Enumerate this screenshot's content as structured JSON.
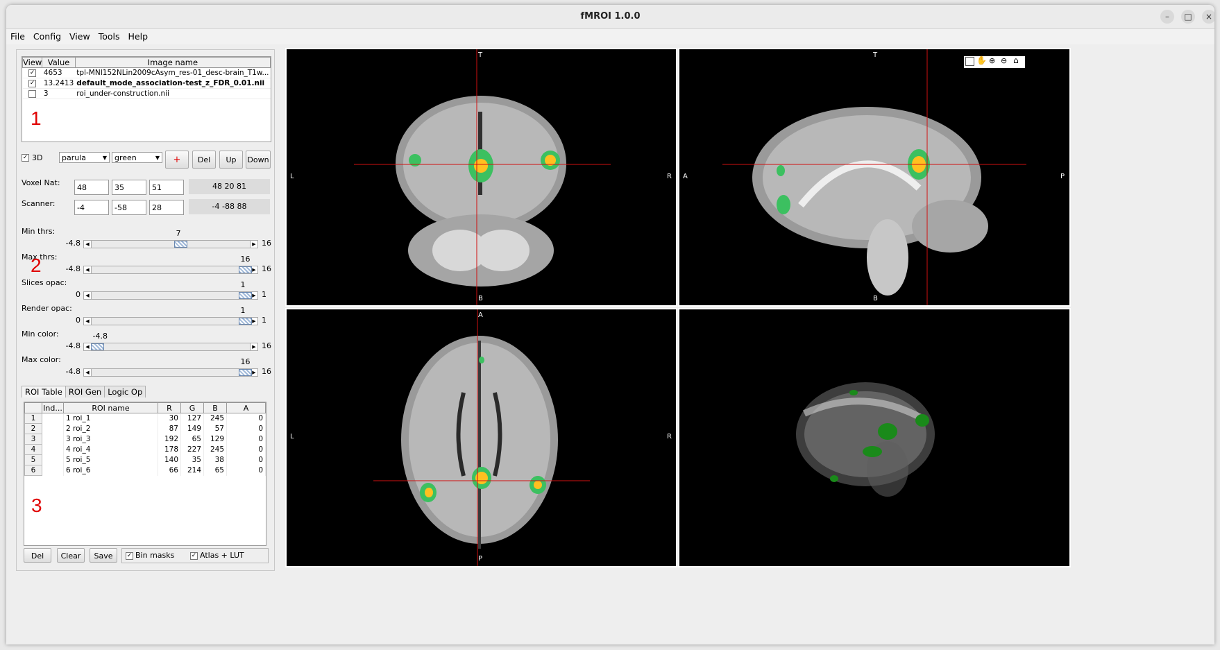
{
  "window": {
    "title": "fMROI 1.0.0",
    "minimize": "–",
    "maximize": "□",
    "close": "×"
  },
  "menu": [
    "File",
    "Config",
    "View",
    "Tools",
    "Help"
  ],
  "layers": {
    "headers": [
      "View",
      "Value",
      "Image name"
    ],
    "rows": [
      {
        "checked": true,
        "value": "4653",
        "name": "tpl-MNI152NLin2009cAsym_res-01_desc-brain_T1w...",
        "bold": false
      },
      {
        "checked": true,
        "value": "13.2413",
        "name": "default_mode_association-test_z_FDR_0.01.nii",
        "bold": true
      },
      {
        "checked": false,
        "value": "3",
        "name": "roi_under-construction.nii",
        "bold": false
      }
    ]
  },
  "annotations": {
    "one": "1",
    "two": "2",
    "three": "3"
  },
  "controls": {
    "three_d_label": "3D",
    "three_d_checked": true,
    "colormap": "parula",
    "color": "green",
    "add_label": "+",
    "del_label": "Del",
    "up_label": "Up",
    "down_label": "Down"
  },
  "coords": {
    "voxel_label": "Voxel Nat:",
    "voxel": [
      "48",
      "35",
      "51"
    ],
    "voxel_readout": "48  20  81",
    "scanner_label": "Scanner:",
    "scanner": [
      "-4",
      "-58",
      "28"
    ],
    "scanner_readout": "-4  -88  88"
  },
  "sliders": [
    {
      "label": "Min thrs:",
      "min": "-4.8",
      "max": "16",
      "value": "7",
      "fraction": 0.565
    },
    {
      "label": "Max thrs:",
      "min": "-4.8",
      "max": "16",
      "value": "16",
      "fraction": 1.0
    },
    {
      "label": "Slices opac:",
      "min": "0",
      "max": "1",
      "value": "1",
      "fraction": 1.0
    },
    {
      "label": "Render opac:",
      "min": "0",
      "max": "1",
      "value": "1",
      "fraction": 1.0
    },
    {
      "label": "Min color:",
      "min": "-4.8",
      "max": "16",
      "value": "-4.8",
      "fraction": 0.0
    },
    {
      "label": "Max color:",
      "min": "-4.8",
      "max": "16",
      "value": "16",
      "fraction": 1.0
    }
  ],
  "tabs": [
    "ROI Table",
    "ROI Gen",
    "Logic Op"
  ],
  "roi_table": {
    "headers": [
      "Ind...",
      "ROI name",
      "R",
      "G",
      "B",
      "A"
    ],
    "rows": [
      {
        "n": "1",
        "name": "1 roi_1",
        "r": "30",
        "g": "127",
        "b": "245",
        "a": "0"
      },
      {
        "n": "2",
        "name": "2 roi_2",
        "r": "87",
        "g": "149",
        "b": "57",
        "a": "0"
      },
      {
        "n": "3",
        "name": "3 roi_3",
        "r": "192",
        "g": "65",
        "b": "129",
        "a": "0"
      },
      {
        "n": "4",
        "name": "4 roi_4",
        "r": "178",
        "g": "227",
        "b": "245",
        "a": "0"
      },
      {
        "n": "5",
        "name": "5 roi_5",
        "r": "140",
        "g": "35",
        "b": "38",
        "a": "0"
      },
      {
        "n": "6",
        "name": "6 roi_6",
        "r": "66",
        "g": "214",
        "b": "65",
        "a": "0"
      }
    ]
  },
  "bottom": {
    "del": "Del",
    "clear": "Clear",
    "save": "Save",
    "bin_masks": "Bin masks",
    "atlas_lut": "Atlas + LUT",
    "bin_checked": true,
    "atlas_checked": true
  },
  "views": {
    "coronal": {
      "top": "T",
      "bottom": "B",
      "left": "L",
      "right": "R"
    },
    "sagittal": {
      "top": "T",
      "bottom": "B",
      "left": "A",
      "right": "P"
    },
    "axial": {
      "top": "A",
      "bottom": "P",
      "left": "L",
      "right": "R"
    }
  },
  "colors": {
    "crosshair": "#d01010",
    "accent_red": "#e00000",
    "blob_green": "#3cc060",
    "blob_yellow": "#ffc020"
  }
}
